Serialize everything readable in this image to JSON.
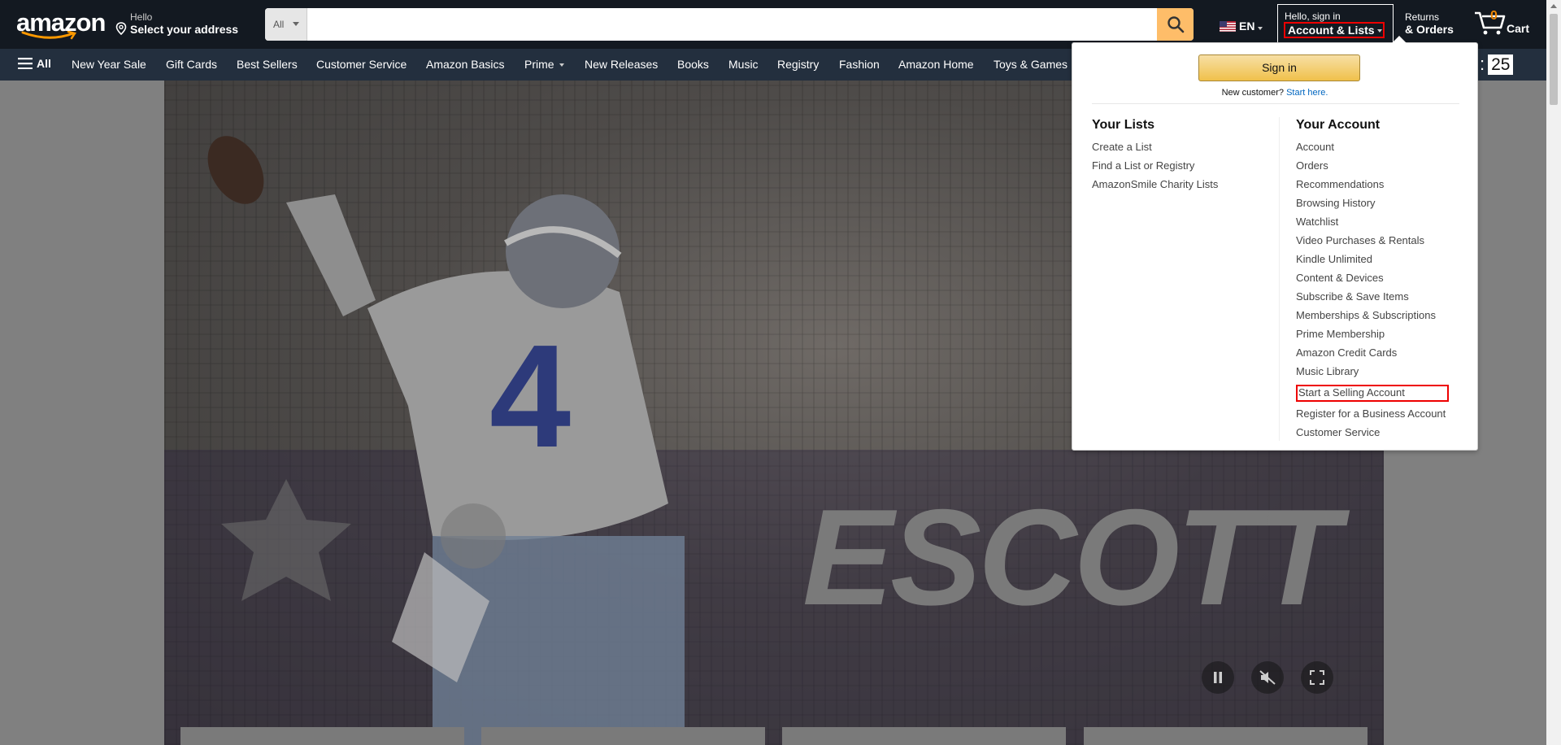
{
  "header": {
    "logo_text": "amazon",
    "address_line1": "Hello",
    "address_line2": "Select your address",
    "search_category": "All",
    "search_placeholder": "",
    "language": "EN",
    "account_line1": "Hello, sign in",
    "account_line2": "Account & Lists",
    "returns_line1": "Returns",
    "returns_line2": "& Orders",
    "cart_count": "0",
    "cart_label": "Cart"
  },
  "subnav": {
    "all_label": "All",
    "items": [
      {
        "label": "New Year Sale"
      },
      {
        "label": "Gift Cards"
      },
      {
        "label": "Best Sellers"
      },
      {
        "label": "Customer Service"
      },
      {
        "label": "Amazon Basics"
      },
      {
        "label": "Prime"
      },
      {
        "label": "New Releases"
      },
      {
        "label": "Books"
      },
      {
        "label": "Music"
      },
      {
        "label": "Registry"
      },
      {
        "label": "Fashion"
      },
      {
        "label": "Amazon Home"
      },
      {
        "label": "Toys & Games"
      }
    ],
    "timer_prefix": ":",
    "timer_value": "25"
  },
  "hero": {
    "overlay_text": "ESCOTT",
    "jersey_number": "4"
  },
  "account_flyout": {
    "signin_label": "Sign in",
    "new_customer_text": "New customer?",
    "start_here_link": "Start here.",
    "your_lists": {
      "heading": "Your Lists",
      "links": [
        "Create a List",
        "Find a List or Registry",
        "AmazonSmile Charity Lists"
      ]
    },
    "your_account": {
      "heading": "Your Account",
      "links": [
        "Account",
        "Orders",
        "Recommendations",
        "Browsing History",
        "Watchlist",
        "Video Purchases & Rentals",
        "Kindle Unlimited",
        "Content & Devices",
        "Subscribe & Save Items",
        "Memberships & Subscriptions",
        "Prime Membership",
        "Amazon Credit Cards",
        "Music Library",
        "Start a Selling Account",
        "Register for a Business Account",
        "Customer Service"
      ]
    }
  },
  "colors": {
    "nav_top": "#131921",
    "nav_sub": "#232f3e",
    "search_button": "#febd69",
    "signin_button": "#f0c14b",
    "highlight": "#ee0000",
    "link_blue": "#0066c0"
  }
}
